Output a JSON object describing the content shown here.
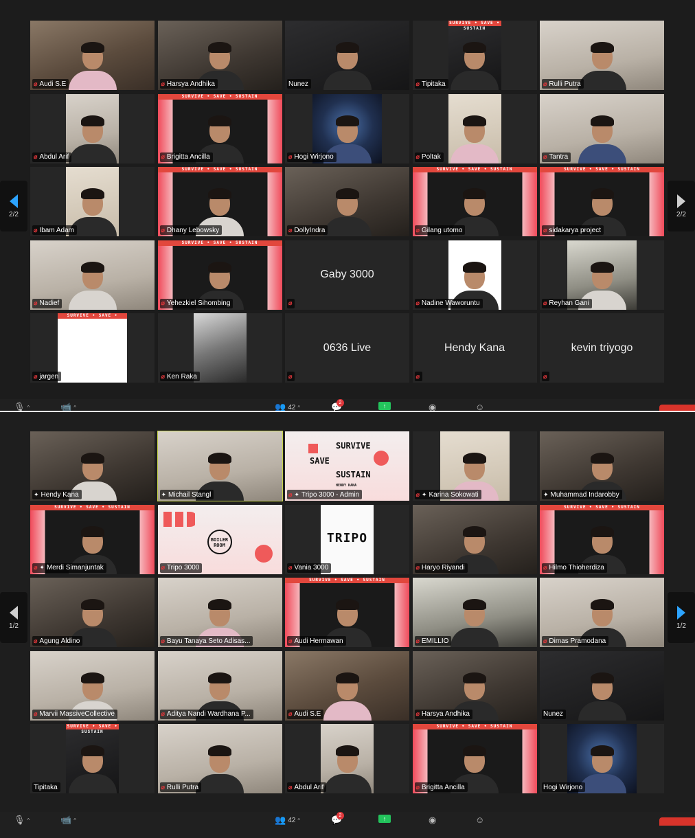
{
  "screens": [
    {
      "page_indicator_left": "2/2",
      "page_indicator_right": "2/2",
      "participant_count": "42",
      "chat_badge": "2",
      "tiles": [
        {
          "name": "Audi S.E",
          "theme": "t-warm",
          "layout": "full",
          "person": "body-pink",
          "muted": true
        },
        {
          "name": "Harsya Andhika",
          "theme": "t-room",
          "layout": "full",
          "person": "",
          "muted": true
        },
        {
          "name": "Nunez",
          "theme": "t-dark",
          "layout": "full",
          "person": "",
          "muted": false
        },
        {
          "name": "Tipitaka",
          "theme": "t-dark",
          "layout": "mid",
          "person": "",
          "muted": true,
          "banner": true
        },
        {
          "name": "Rulli Putra",
          "theme": "t-wall",
          "layout": "full",
          "person": "",
          "muted": true
        },
        {
          "name": "Abdul Arif",
          "theme": "t-wall",
          "layout": "mid",
          "person": "",
          "muted": true
        },
        {
          "name": "Brigitta Ancilla",
          "theme": "t-pink",
          "layout": "full",
          "person": "",
          "muted": true,
          "banner": true
        },
        {
          "name": "Hogi Wirjono",
          "theme": "t-blue",
          "layout": "narrow",
          "person": "body-blue",
          "muted": true
        },
        {
          "name": "Poltak",
          "theme": "t-beige",
          "layout": "mid",
          "person": "body-pink",
          "muted": true
        },
        {
          "name": "Tantra",
          "theme": "t-wall",
          "layout": "full",
          "person": "body-blue",
          "muted": true
        },
        {
          "name": "Ibam Adam",
          "theme": "t-beige",
          "layout": "mid",
          "person": "",
          "muted": true
        },
        {
          "name": "Dhany Lebowsky",
          "theme": "t-pink",
          "layout": "full",
          "person": "body-light",
          "muted": true,
          "banner": true
        },
        {
          "name": "DollyIndra",
          "theme": "t-room",
          "layout": "full",
          "person": "",
          "muted": true
        },
        {
          "name": "Gilang utomo",
          "theme": "t-pink",
          "layout": "full",
          "person": "",
          "muted": true,
          "banner": true
        },
        {
          "name": "sidakarya project",
          "theme": "t-pink",
          "layout": "full",
          "person": "",
          "muted": true,
          "banner": true
        },
        {
          "name": "Nadief",
          "theme": "t-wall",
          "layout": "full",
          "person": "body-light",
          "muted": true
        },
        {
          "name": "Yehezkiel Sihombing",
          "theme": "t-pink",
          "layout": "full",
          "person": "",
          "muted": true,
          "banner": true
        },
        {
          "name": "",
          "center": "Gaby 3000",
          "theme": "",
          "layout": "none",
          "person": "none",
          "muted": true
        },
        {
          "name": "Nadine Waworuntu",
          "theme": "t-white",
          "layout": "mid",
          "person": "",
          "muted": true
        },
        {
          "name": "Reyhan Gani",
          "theme": "t-green",
          "layout": "narrow",
          "person": "body-light",
          "muted": true
        },
        {
          "name": "jargen",
          "theme": "t-white",
          "layout": "narrow",
          "person": "none",
          "muted": true,
          "banner": true
        },
        {
          "name": "Ken Raka",
          "theme": "t-helm",
          "layout": "mid",
          "person": "none",
          "muted": true
        },
        {
          "name": "",
          "center": "0636 Live",
          "theme": "",
          "layout": "none",
          "person": "none",
          "muted": true
        },
        {
          "name": "",
          "center": "Hendy Kana",
          "theme": "",
          "layout": "none",
          "person": "none",
          "muted": true
        },
        {
          "name": "",
          "center": "kevin triyogo",
          "theme": "",
          "layout": "none",
          "person": "none",
          "muted": true
        }
      ]
    },
    {
      "page_indicator_left": "1/2",
      "page_indicator_right": "1/2",
      "participant_count": "42",
      "chat_badge": "2",
      "tiles": [
        {
          "name": "Hendy Kana",
          "theme": "t-room",
          "layout": "full",
          "person": "body-light",
          "muted": false,
          "pinned": true
        },
        {
          "name": "Michail Stangl",
          "theme": "t-wall",
          "layout": "full",
          "person": "",
          "muted": false,
          "pinned": true,
          "active": true
        },
        {
          "name": "Tripo 3000 - Admin",
          "theme": "t-poster",
          "layout": "full",
          "person": "none",
          "muted": true,
          "pinned": true,
          "poster": [
            "SURVIVE",
            "SAVE",
            "SUSTAIN",
            "HENDY KANA"
          ]
        },
        {
          "name": "Karina Sokowati",
          "theme": "t-beige",
          "layout": "narrow",
          "person": "body-pink",
          "muted": true,
          "pinned": true
        },
        {
          "name": "Muhammad Indarobby",
          "theme": "t-room",
          "layout": "full",
          "person": "",
          "muted": false,
          "pinned": true
        },
        {
          "name": "Merdi Simanjuntak",
          "theme": "t-pink",
          "layout": "full",
          "person": "",
          "muted": true,
          "pinned": true,
          "banner": true
        },
        {
          "name": "Tripo 3000",
          "theme": "t-poster",
          "layout": "full",
          "person": "none",
          "muted": true,
          "logo": "BOILER ROOM"
        },
        {
          "name": "Vania 3000",
          "theme": "t-tripo",
          "layout": "mid",
          "person": "none",
          "muted": true,
          "logo": "TRIPO"
        },
        {
          "name": "Haryo Riyandi",
          "theme": "t-room",
          "layout": "full",
          "person": "",
          "muted": true
        },
        {
          "name": "Hilmo Thioherdiza",
          "theme": "t-pink",
          "layout": "full",
          "person": "",
          "muted": true,
          "banner": true
        },
        {
          "name": "Agung Aldino",
          "theme": "t-room",
          "layout": "full",
          "person": "",
          "muted": true
        },
        {
          "name": "Bayu Tanaya Seto Adisas...",
          "theme": "t-wall",
          "layout": "full",
          "person": "body-pink",
          "muted": true
        },
        {
          "name": "Audi Hermawan",
          "theme": "t-pink",
          "layout": "full",
          "person": "",
          "muted": true,
          "banner": true
        },
        {
          "name": "EMILLIO",
          "theme": "t-green",
          "layout": "full",
          "person": "",
          "muted": true
        },
        {
          "name": "Dimas Pramodana",
          "theme": "t-wall",
          "layout": "full",
          "person": "",
          "muted": true
        },
        {
          "name": "Marvii MassiveCollective",
          "theme": "t-wall",
          "layout": "full",
          "person": "body-light",
          "muted": true
        },
        {
          "name": "Aditya Nandi Wardhana P...",
          "theme": "t-wall",
          "layout": "full",
          "person": "",
          "muted": true
        },
        {
          "name": "Audi S.E",
          "theme": "t-warm",
          "layout": "full",
          "person": "body-pink",
          "muted": true
        },
        {
          "name": "Harsya Andhika",
          "theme": "t-room",
          "layout": "full",
          "person": "",
          "muted": true
        },
        {
          "name": "Nunez",
          "theme": "t-dark",
          "layout": "full",
          "person": "",
          "muted": false
        },
        {
          "name": "Tipitaka",
          "theme": "t-dark",
          "layout": "mid",
          "person": "",
          "muted": false,
          "banner": true
        },
        {
          "name": "Rulli Putra",
          "theme": "t-wall",
          "layout": "full",
          "person": "",
          "muted": true
        },
        {
          "name": "Abdul Arif",
          "theme": "t-wall",
          "layout": "mid",
          "person": "",
          "muted": true
        },
        {
          "name": "Brigitta Ancilla",
          "theme": "t-pink",
          "layout": "full",
          "person": "",
          "muted": true,
          "banner": true
        },
        {
          "name": "Hogi Wirjono",
          "theme": "t-blue",
          "layout": "narrow",
          "person": "body-blue",
          "muted": false
        }
      ]
    }
  ],
  "banner_text": "SURVIVE • SAVE • SUSTAIN",
  "colors": {
    "muted": "#e0373b",
    "active_speaker": "#c7d44a",
    "share": "#23c35c",
    "page_arrow_blue": "#2da4ff"
  },
  "icons": {
    "mute": "mic-off-icon",
    "video": "video-off-icon",
    "participants": "participants-icon",
    "chat": "chat-icon",
    "share": "share-screen-icon",
    "record": "record-icon",
    "reactions": "reactions-icon",
    "pin": "pin-icon"
  }
}
